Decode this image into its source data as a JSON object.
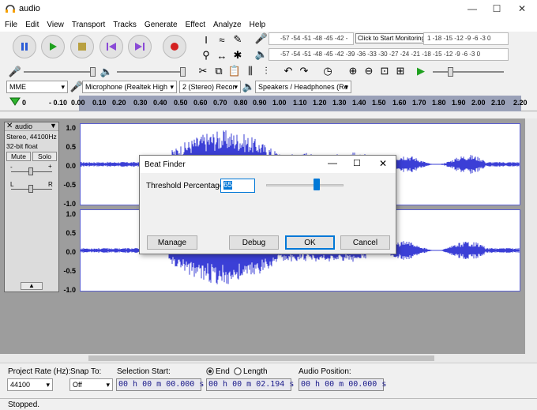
{
  "window": {
    "title": "audio"
  },
  "menu": [
    "File",
    "Edit",
    "View",
    "Transport",
    "Tracks",
    "Generate",
    "Effect",
    "Analyze",
    "Help"
  ],
  "meters": {
    "record_label": "Click to Start Monitoring",
    "record_scale_left": "-57 -54 -51 -48 -45 -42 -",
    "record_scale_right": "1 -18 -15 -12 -9 -6 -3 0",
    "play_scale": "-57 -54 -51 -48 -45 -42 -39 -36 -33 -30 -27 -24 -21 -18 -15 -12 -9 -6 -3 0"
  },
  "device": {
    "host": "MME",
    "input": "Microphone (Realtek High",
    "channels": "2 (Stereo) Recor",
    "output": "Speakers / Headphones (Re"
  },
  "ruler": {
    "ticks": [
      "0",
      "- 0.10",
      "0.00",
      "0.10",
      "0.20",
      "0.30",
      "0.40",
      "0.50",
      "0.60",
      "0.70",
      "0.80",
      "0.90",
      "1.00",
      "1.10",
      "1.20",
      "1.30",
      "1.40",
      "1.50",
      "1.60",
      "1.70",
      "1.80",
      "1.90",
      "2.00",
      "2.10",
      "2.20"
    ]
  },
  "track": {
    "name": "audio",
    "format_line1": "Stereo, 44100Hz",
    "format_line2": "32-bit float",
    "mute": "Mute",
    "solo": "Solo",
    "gain_minus": "-",
    "gain_plus": "+",
    "pan_left": "L",
    "pan_right": "R",
    "y_axis": [
      "1.0",
      "0.5",
      "0.0",
      "-0.5",
      "-1.0"
    ]
  },
  "dialog": {
    "title": "Beat Finder",
    "threshold_label": "Threshold Percentage:",
    "threshold_value": "65",
    "threshold_fraction": 0.65,
    "manage": "Manage",
    "debug": "Debug",
    "ok": "OK",
    "cancel": "Cancel"
  },
  "selection": {
    "project_rate_label": "Project Rate (Hz):",
    "project_rate": "44100",
    "snap_to_label": "Snap To:",
    "snap_to": "Off",
    "selection_start_label": "Selection Start:",
    "end_label": "End",
    "length_label": "Length",
    "audio_position_label": "Audio Position:",
    "start_time": "00 h 00 m 00.000 s",
    "end_time": "00 h 00 m 02.194 s",
    "audio_position": "00 h 00 m 00.000 s"
  },
  "status": "Stopped.",
  "colors": {
    "waveform": "#3b3fd6",
    "accent": "#0078d7"
  }
}
